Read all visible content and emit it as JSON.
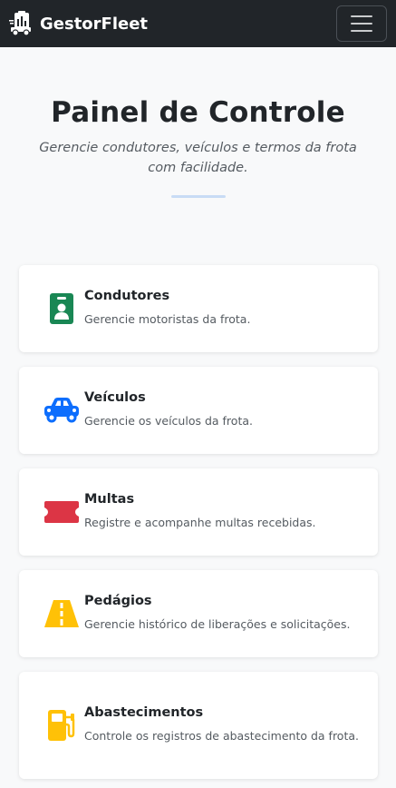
{
  "navbar": {
    "brand": "GestorFleet",
    "brand_icon": "truck-clipboard-icon",
    "menu_icon": "hamburger-menu-icon"
  },
  "hero": {
    "title": "Painel de Controle",
    "subtitle": "Gerencie condutores, veículos e termos da frota com facilidade.",
    "accent_color": "#c8dcf5"
  },
  "cards": [
    {
      "title": "Condutores",
      "description": "Gerencie motoristas da frota.",
      "icon": "id-badge-icon",
      "color": "#198754"
    },
    {
      "title": "Veículos",
      "description": "Gerencie os veículos da frota.",
      "icon": "car-icon",
      "color": "#0d6efd"
    },
    {
      "title": "Multas",
      "description": "Registre e acompanhe multas recebidas.",
      "icon": "ticket-icon",
      "color": "#dc3545"
    },
    {
      "title": "Pedágios",
      "description": "Gerencie histórico de liberações e solicitações.",
      "icon": "road-icon",
      "color": "#ffc107"
    },
    {
      "title": "Abastecimentos",
      "description": "Controle os registros de abastecimento da frota.",
      "icon": "fuel-pump-icon",
      "color": "#ffc107"
    }
  ]
}
